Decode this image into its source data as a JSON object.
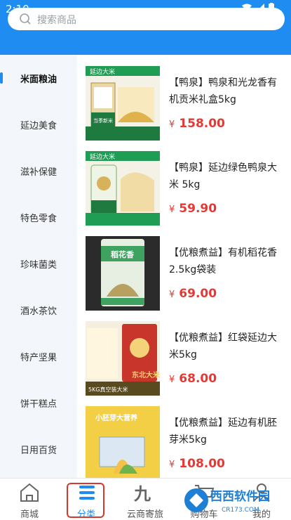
{
  "status": {
    "time": "2:10"
  },
  "search": {
    "placeholder": "搜索商品"
  },
  "sidebar": {
    "items": [
      {
        "label": "米面粮油",
        "active": true
      },
      {
        "label": "延边美食"
      },
      {
        "label": "滋补保健"
      },
      {
        "label": "特色零食"
      },
      {
        "label": "珍味菌类"
      },
      {
        "label": "酒水茶饮"
      },
      {
        "label": "特产坚果"
      },
      {
        "label": "饼干糕点"
      },
      {
        "label": "日用百货"
      }
    ]
  },
  "products": [
    {
      "name": "【鸭泉】鸭泉和光龙香有机贡米礼盒5kg",
      "currency": "¥",
      "price": "158.00",
      "image_text": [
        "延边大米",
        "当季新米"
      ]
    },
    {
      "name": "【鸭泉】延边绿色鸭泉大米 5kg",
      "currency": "¥",
      "price": "59.90",
      "image_text": [
        "延边大米"
      ]
    },
    {
      "name": "【优粮煮益】有机稻花香 2.5kg袋装",
      "currency": "¥",
      "price": "69.00",
      "image_text": [
        "稻花香"
      ]
    },
    {
      "name": "【优粮煮益】红袋延边大米5kg",
      "currency": "¥",
      "price": "68.00",
      "image_text": [
        "5KG真空装大米",
        "东北大米"
      ]
    },
    {
      "name": "【优粮煮益】延边有机胚芽米5kg",
      "currency": "¥",
      "price": "108.00",
      "image_text": [
        "小胚芽大营养"
      ]
    }
  ],
  "tabbar": {
    "tabs": [
      {
        "label": "商城"
      },
      {
        "label": "分类",
        "active": true
      },
      {
        "label": "云商寄旅"
      },
      {
        "label": "购物车"
      },
      {
        "label": "我的"
      }
    ]
  },
  "watermark": {
    "text": "西西软件园",
    "sub": "CR173.COM"
  },
  "colors": {
    "primary": "#1e8cf0",
    "price": "#e53935",
    "highlight": "#d9372b"
  }
}
